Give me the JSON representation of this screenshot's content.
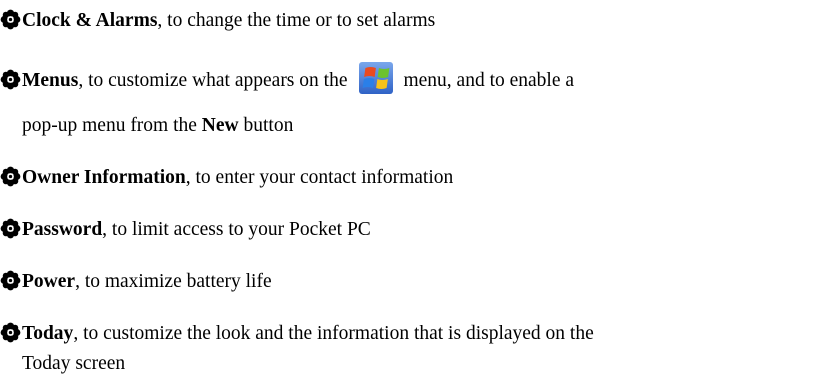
{
  "items": [
    {
      "name": "Clock & Alarms",
      "text": ", to change the time or to set alarms"
    },
    {
      "name": "Menus",
      "text_before_icon": ", to customize what appears on the",
      "text_after_icon": "menu, and to enable a",
      "continuation_before": "pop-up menu from the",
      "continuation_bold": "New",
      "continuation_after": "button"
    },
    {
      "name": "Owner Information",
      "text": ", to enter your contact information"
    },
    {
      "name": "Password",
      "text": ", to limit access to your Pocket PC"
    },
    {
      "name": "Power",
      "text": ", to maximize battery life"
    },
    {
      "name": "Today",
      "text": ", to customize the look and the information that is displayed on the",
      "continuation": "Today screen"
    }
  ],
  "icons": {
    "bullet": "flower-bullet-icon",
    "start_menu": "windows-start-logo-icon"
  },
  "colors": {
    "text": "#000000",
    "background": "#ffffff",
    "logo_tile": "#4a7ed8"
  }
}
